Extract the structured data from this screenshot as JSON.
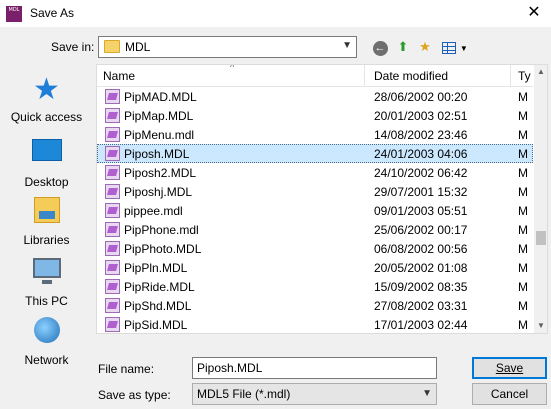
{
  "window": {
    "title": "Save As",
    "app_icon_text": "MDL"
  },
  "savein": {
    "label": "Save in:",
    "value": "MDL"
  },
  "places": [
    {
      "label": "Quick access",
      "icon": "quick-access-star-icon"
    },
    {
      "label": "Desktop",
      "icon": "desktop-icon"
    },
    {
      "label": "Libraries",
      "icon": "libraries-icon"
    },
    {
      "label": "This PC",
      "icon": "this-pc-icon"
    },
    {
      "label": "Network",
      "icon": "network-icon"
    }
  ],
  "columns": {
    "name": "Name",
    "date": "Date modified",
    "type": "Ty"
  },
  "files": [
    {
      "name": "PipMAD.MDL",
      "date": "28/06/2002 00:20",
      "type": "M"
    },
    {
      "name": "PipMap.MDL",
      "date": "20/01/2003 02:51",
      "type": "M"
    },
    {
      "name": "PipMenu.mdl",
      "date": "14/08/2002 23:46",
      "type": "M"
    },
    {
      "name": "Piposh.MDL",
      "date": "24/01/2003 04:06",
      "type": "M",
      "selected": true
    },
    {
      "name": "Piposh2.MDL",
      "date": "24/10/2002 06:42",
      "type": "M"
    },
    {
      "name": "Piposhj.MDL",
      "date": "29/07/2001 15:32",
      "type": "M"
    },
    {
      "name": "pippee.mdl",
      "date": "09/01/2003 05:51",
      "type": "M"
    },
    {
      "name": "PipPhone.mdl",
      "date": "25/06/2002 00:17",
      "type": "M"
    },
    {
      "name": "PipPhoto.MDL",
      "date": "06/08/2002 00:56",
      "type": "M"
    },
    {
      "name": "PipPln.MDL",
      "date": "20/05/2002 01:08",
      "type": "M"
    },
    {
      "name": "PipRide.MDL",
      "date": "15/09/2002 08:35",
      "type": "M"
    },
    {
      "name": "PipShd.MDL",
      "date": "27/08/2002 03:31",
      "type": "M"
    },
    {
      "name": "PipSid.MDL",
      "date": "17/01/2003 02:44",
      "type": "M"
    }
  ],
  "filename": {
    "label": "File name:",
    "value": "Piposh.MDL"
  },
  "savetype": {
    "label": "Save as type:",
    "value": "MDL5 File (*.mdl)"
  },
  "buttons": {
    "save": "Save",
    "cancel": "Cancel"
  },
  "colors": {
    "selection": "#cce8ff",
    "accent": "#0078d7"
  }
}
